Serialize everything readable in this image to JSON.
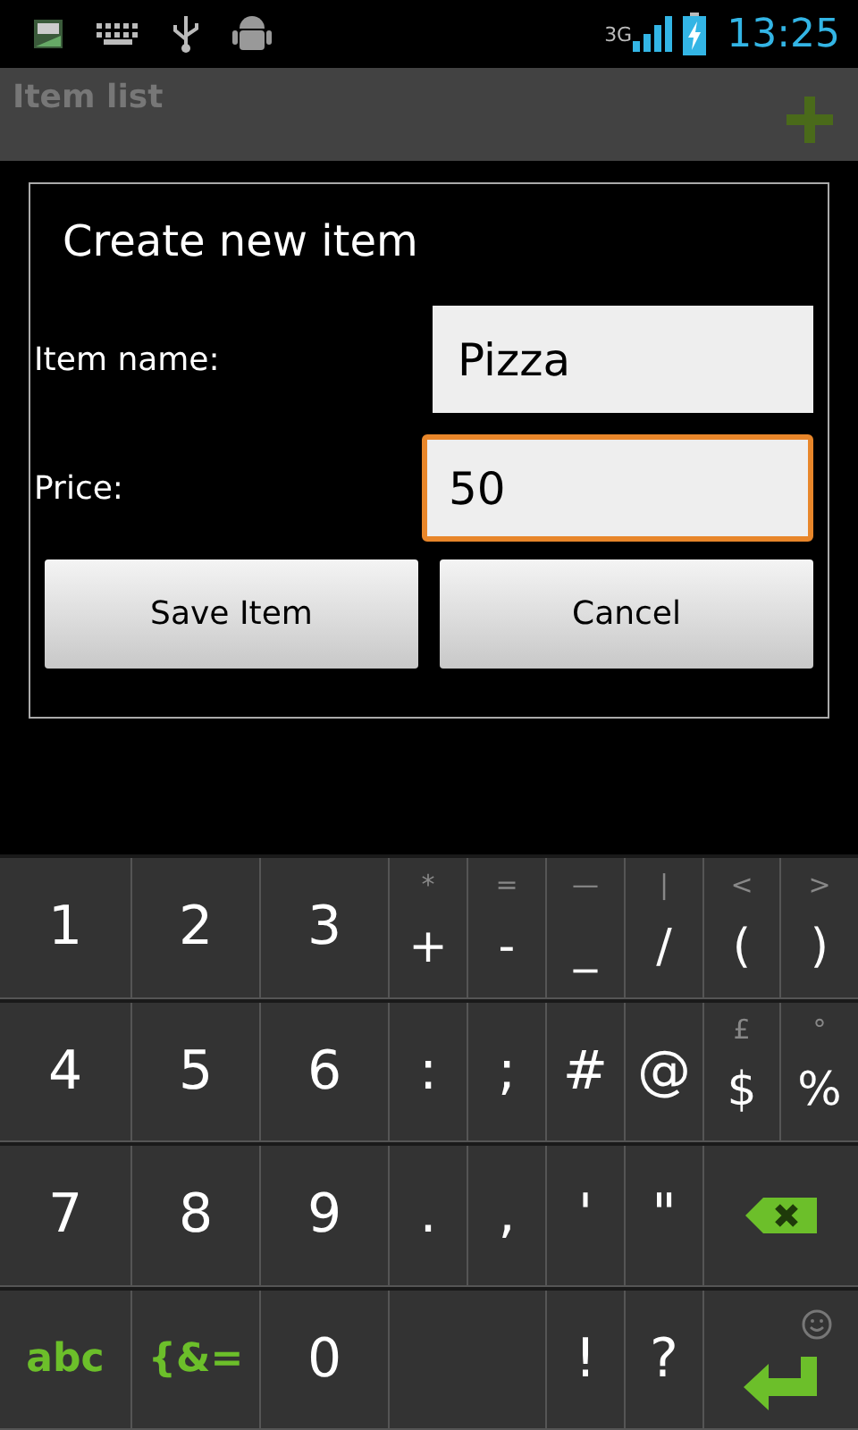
{
  "status_bar": {
    "network": "3G",
    "time": "13:25"
  },
  "action_bar": {
    "title": "Item list"
  },
  "dialog": {
    "title": "Create new item",
    "fields": [
      {
        "label": "Item name:",
        "value": "Pizza",
        "focused": false
      },
      {
        "label": "Price:",
        "value": "50",
        "focused": true
      }
    ],
    "buttons": [
      "Save Item",
      "Cancel"
    ]
  },
  "keyboard": {
    "rows": [
      [
        {
          "kind": "char",
          "label": "1"
        },
        {
          "kind": "char",
          "label": "2"
        },
        {
          "kind": "char",
          "label": "3"
        },
        {
          "kind": "char",
          "label": "+",
          "hint": "*"
        },
        {
          "kind": "char",
          "label": "-",
          "hint": "="
        },
        {
          "kind": "char",
          "label": "_",
          "hint": "—"
        },
        {
          "kind": "char",
          "label": "/",
          "hint": "|"
        },
        {
          "kind": "char",
          "label": "(",
          "hint": "<"
        },
        {
          "kind": "char",
          "label": ")",
          "hint": ">"
        }
      ],
      [
        {
          "kind": "char",
          "label": "4"
        },
        {
          "kind": "char",
          "label": "5"
        },
        {
          "kind": "char",
          "label": "6"
        },
        {
          "kind": "char",
          "label": ":"
        },
        {
          "kind": "char",
          "label": ";"
        },
        {
          "kind": "char",
          "label": "#"
        },
        {
          "kind": "char",
          "label": "@"
        },
        {
          "kind": "char",
          "label": "$",
          "hint": "£"
        },
        {
          "kind": "char",
          "label": "%",
          "hint": "°"
        }
      ],
      [
        {
          "kind": "char",
          "label": "7"
        },
        {
          "kind": "char",
          "label": "8"
        },
        {
          "kind": "char",
          "label": "9"
        },
        {
          "kind": "char",
          "label": "."
        },
        {
          "kind": "char",
          "label": ","
        },
        {
          "kind": "char",
          "label": "'"
        },
        {
          "kind": "char",
          "label": "\""
        },
        {
          "kind": "backspace"
        },
        ""
      ],
      [
        {
          "kind": "mode",
          "label": "abc"
        },
        {
          "kind": "mode",
          "label": "{&="
        },
        {
          "kind": "char",
          "label": "0"
        },
        {
          "kind": "space"
        },
        "",
        {
          "kind": "char",
          "label": "!"
        },
        {
          "kind": "char",
          "label": "?"
        },
        {
          "kind": "enter"
        },
        ""
      ]
    ]
  }
}
